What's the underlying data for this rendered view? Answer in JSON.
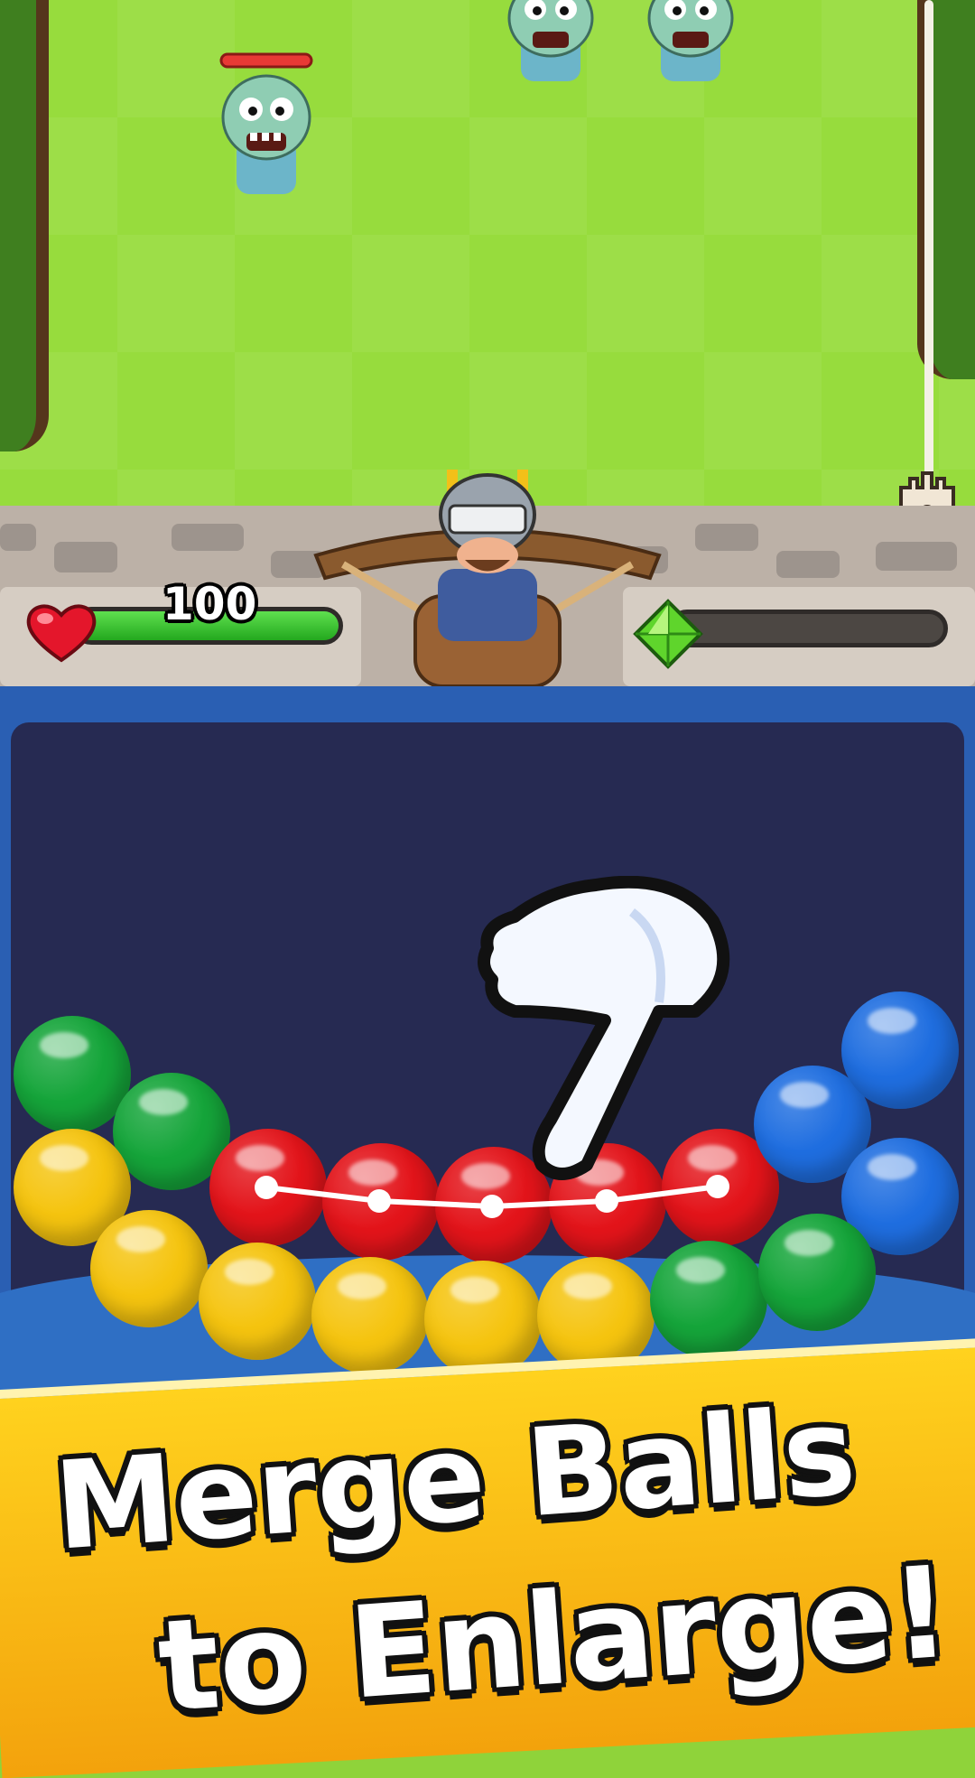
{
  "game": {
    "player_health": "100",
    "health_fraction": 1.0,
    "gem_fraction": 0.0,
    "icons": [
      "heart-icon",
      "green-gem-icon",
      "castle-icon",
      "pointing-hand-icon"
    ]
  },
  "board": {
    "ball_colors": {
      "red": "#e3141a",
      "yellow": "#f5c40f",
      "green": "#15a53a",
      "blue": "#1f6ee0"
    },
    "balls": [
      {
        "color": "green",
        "label": "green"
      },
      {
        "color": "green",
        "label": "green"
      },
      {
        "color": "yellow",
        "label": "yellow"
      },
      {
        "color": "red",
        "label": "red-selected"
      },
      {
        "color": "red",
        "label": "red-selected"
      },
      {
        "color": "red",
        "label": "red-selected"
      },
      {
        "color": "red",
        "label": "red-selected"
      },
      {
        "color": "red",
        "label": "red-selected"
      },
      {
        "color": "blue",
        "label": "blue"
      },
      {
        "color": "blue",
        "label": "blue"
      },
      {
        "color": "blue",
        "label": "blue"
      },
      {
        "color": "yellow",
        "label": "yellow"
      },
      {
        "color": "yellow",
        "label": "yellow"
      },
      {
        "color": "yellow",
        "label": "yellow"
      },
      {
        "color": "yellow",
        "label": "yellow"
      },
      {
        "color": "yellow",
        "label": "yellow"
      },
      {
        "color": "green",
        "label": "green"
      },
      {
        "color": "green",
        "label": "green"
      }
    ]
  },
  "banner": {
    "line1": "Merge Balls",
    "line2": "to Enlarge!"
  }
}
